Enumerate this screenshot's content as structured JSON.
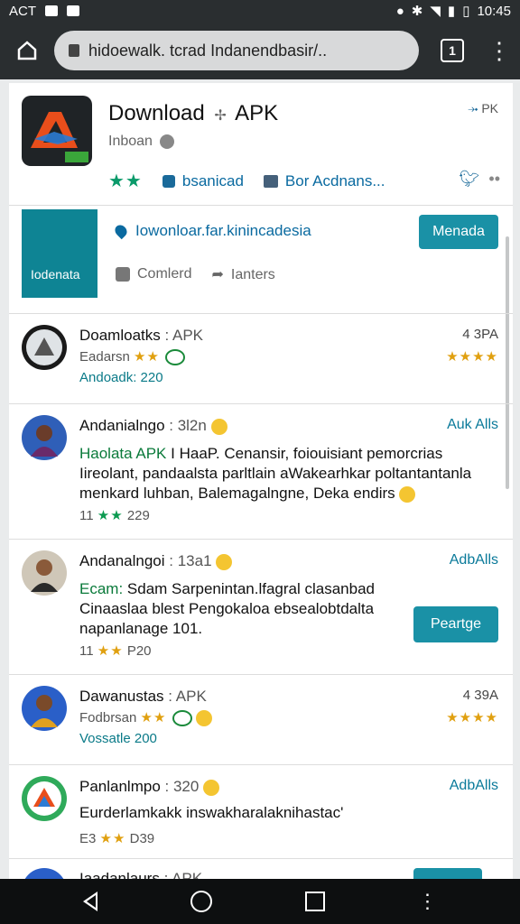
{
  "status_bar": {
    "carrier": "ACT",
    "time": "10:45"
  },
  "url_bar": {
    "url": "hidoewalk. tcrad Indanendbasir/..",
    "tabs_count": "1"
  },
  "app": {
    "title": "Download",
    "title_suffix": "APK",
    "subtitle": "Inboan",
    "pk_tag": "PK",
    "stars": "★★",
    "link_1": "bsanicad",
    "link_2": "Bor Acdnans..."
  },
  "banner": {
    "teal_label": "Iodenata",
    "link": "Iowonloar.far.kinincadesia",
    "action_1": "Comlerd",
    "action_2": "Ianters",
    "button": "Menada"
  },
  "items": [
    {
      "title": "Doamloatks",
      "tag": "APK",
      "line1": "Eadarsn",
      "stars1": "★★",
      "line2": "Andoadk: 220",
      "right_top": "4 3PA",
      "right_stars": "★★★★"
    },
    {
      "title": "Andanialngo",
      "time": "3l2n",
      "right_link": "Auk Alls",
      "body_green": "Haolata APK",
      "body": "I HaaP. Cenansir, foiouisiant pemorcrias Iireolant, pandaalsta parltlain aWakearhkar poltantantanla menkard luhban, Balemagalngne, Deka endirs",
      "meta_count": "11",
      "meta_stars": "★★",
      "meta_num": "229"
    },
    {
      "title": "Andanalngoi",
      "time": "13a1",
      "right_link": "AdbAlls",
      "body_green": "Ecam:",
      "body": "Sdam Sarpenintan.lfagral clasanbad Cinaaslaa blest Pengokaloa ebsealobtdalta napanlanage 101.",
      "meta_count": "11",
      "meta_stars": "★★",
      "meta_num": "P20",
      "button": "Peartge"
    },
    {
      "title": "Dawanustas",
      "tag": "APK",
      "line1": "Fodbrsan",
      "stars1": "★★",
      "line2": "Vossatle 200",
      "right_top": "4 39A",
      "right_stars": "★★★★"
    },
    {
      "title": "Panlanlmpo",
      "time": "320",
      "right_link": "AdbAlls",
      "body": "Eurderlamkakk inswakharalaknihastac'",
      "meta_count": "E3",
      "meta_stars": "★★",
      "meta_num": "D39"
    },
    {
      "title": "Iaadanlaurs",
      "tag": "APK"
    }
  ],
  "icons": [
    "home-icon",
    "lock-icon",
    "tabs-icon",
    "menu-icon",
    "globe-icon",
    "share-icon",
    "back-icon",
    "circle-home-icon",
    "recents-icon"
  ],
  "colors": {
    "teal": "#1a91a6",
    "star_gold": "#e0a010",
    "link_blue": "#0a6aa0",
    "chrome_dark": "#2a2e30"
  }
}
